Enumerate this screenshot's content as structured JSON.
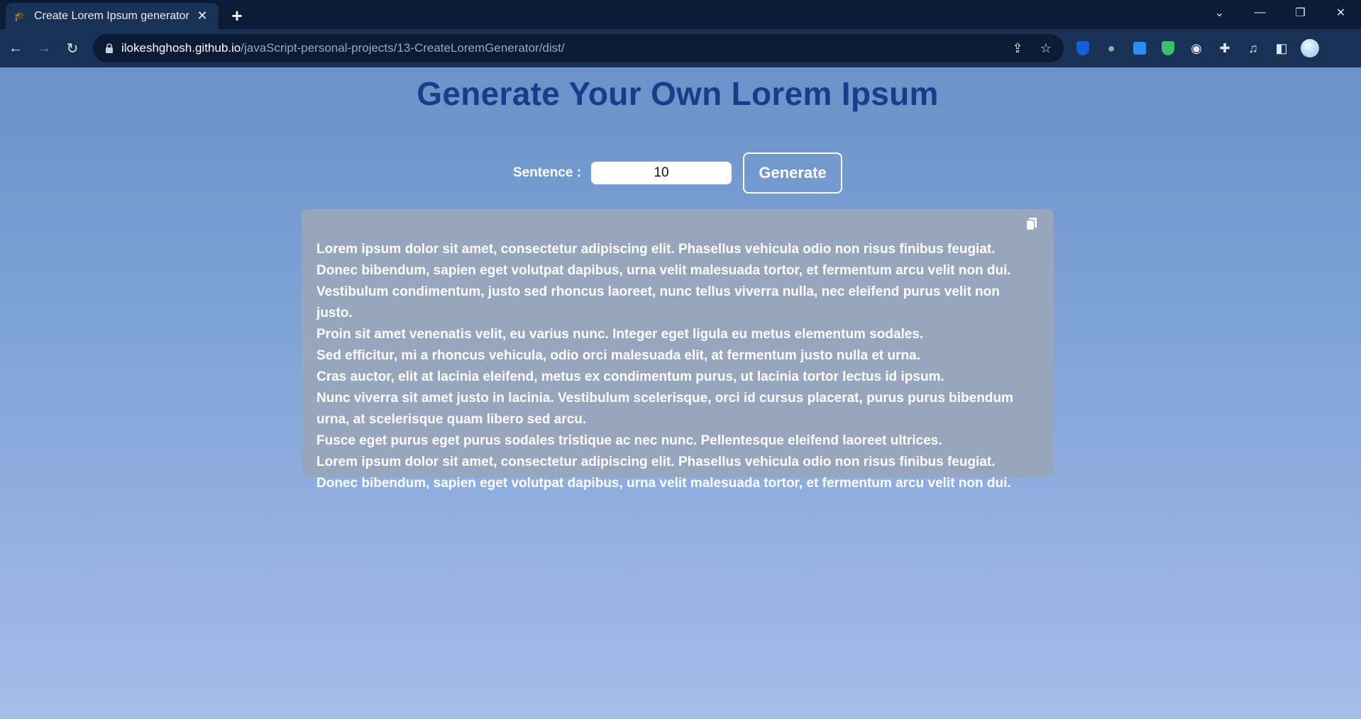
{
  "browser": {
    "tab": {
      "title": "Create Lorem Ipsum generator",
      "close_glyph": "✕",
      "favicon": "mortarboard-icon"
    },
    "new_tab_glyph": "+",
    "window_controls": {
      "tab_search": "⌄",
      "minimize": "—",
      "restore": "❐",
      "close": "✕"
    },
    "nav": {
      "back": "←",
      "forward": "→",
      "reload": "↻"
    },
    "address": {
      "host": "ilokeshghosh.github.io",
      "path": "/javaScript-personal-projects/13-CreateLoremGenerator/dist/"
    },
    "omni_actions": {
      "share": "⇪",
      "bookmark": "☆"
    },
    "extensions": {
      "puzzle": "✚",
      "media": "♫",
      "sidepanel": "◧",
      "camera": "◉",
      "light": "●"
    }
  },
  "page": {
    "title": "Generate Your Own Lorem Ipsum",
    "form": {
      "sentence_label": "Sentence :",
      "sentence_value": "10",
      "generate_label": "Generate"
    },
    "output": {
      "lines": [
        "Lorem ipsum dolor sit amet, consectetur adipiscing elit. Phasellus vehicula odio non risus finibus feugiat.",
        "Donec bibendum, sapien eget volutpat dapibus, urna velit malesuada tortor, et fermentum arcu velit non dui.",
        "Vestibulum condimentum, justo sed rhoncus laoreet, nunc tellus viverra nulla, nec eleifend purus velit non justo.",
        "Proin sit amet venenatis velit, eu varius nunc. Integer eget ligula eu metus elementum sodales.",
        "Sed efficitur, mi a rhoncus vehicula, odio orci malesuada elit, at fermentum justo nulla et urna.",
        "Cras auctor, elit at lacinia eleifend, metus ex condimentum purus, ut lacinia tortor lectus id ipsum.",
        "Nunc viverra sit amet justo in lacinia. Vestibulum scelerisque, orci id cursus placerat, purus purus bibendum",
        "urna, at scelerisque quam libero sed arcu.",
        "Fusce eget purus eget purus sodales tristique ac nec nunc. Pellentesque eleifend laoreet ultrices.",
        "Lorem ipsum dolor sit amet, consectetur adipiscing elit. Phasellus vehicula odio non risus finibus feugiat.",
        "Donec bibendum, sapien eget volutpat dapibus, urna velit malesuada tortor, et fermentum arcu velit non dui."
      ]
    }
  },
  "colors": {
    "title": "#1e3a8a",
    "panel": "#97a6bd",
    "background_top": "#6a93c9",
    "background_bottom": "#a4bdea"
  }
}
